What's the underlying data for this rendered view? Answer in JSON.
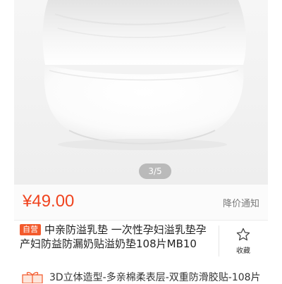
{
  "gallery": {
    "counter": "3/5"
  },
  "price_bar": {
    "price": "¥49.00",
    "notice_label": "降价通知",
    "price_color": "#f0441f"
  },
  "product": {
    "badge": "自营",
    "title": "中亲防溢乳垫 一次性孕妇溢乳垫孕产妇防益防漏奶贴溢奶垫108片MB10",
    "favorite_label": "收藏",
    "badge_color": "#f35a2c"
  },
  "promo": {
    "text": "3D立体造型-多亲棉柔表层-双重防滑胶贴-108片",
    "icon": "gift-icon"
  },
  "icons": {
    "favorite": "star-outline-icon"
  }
}
